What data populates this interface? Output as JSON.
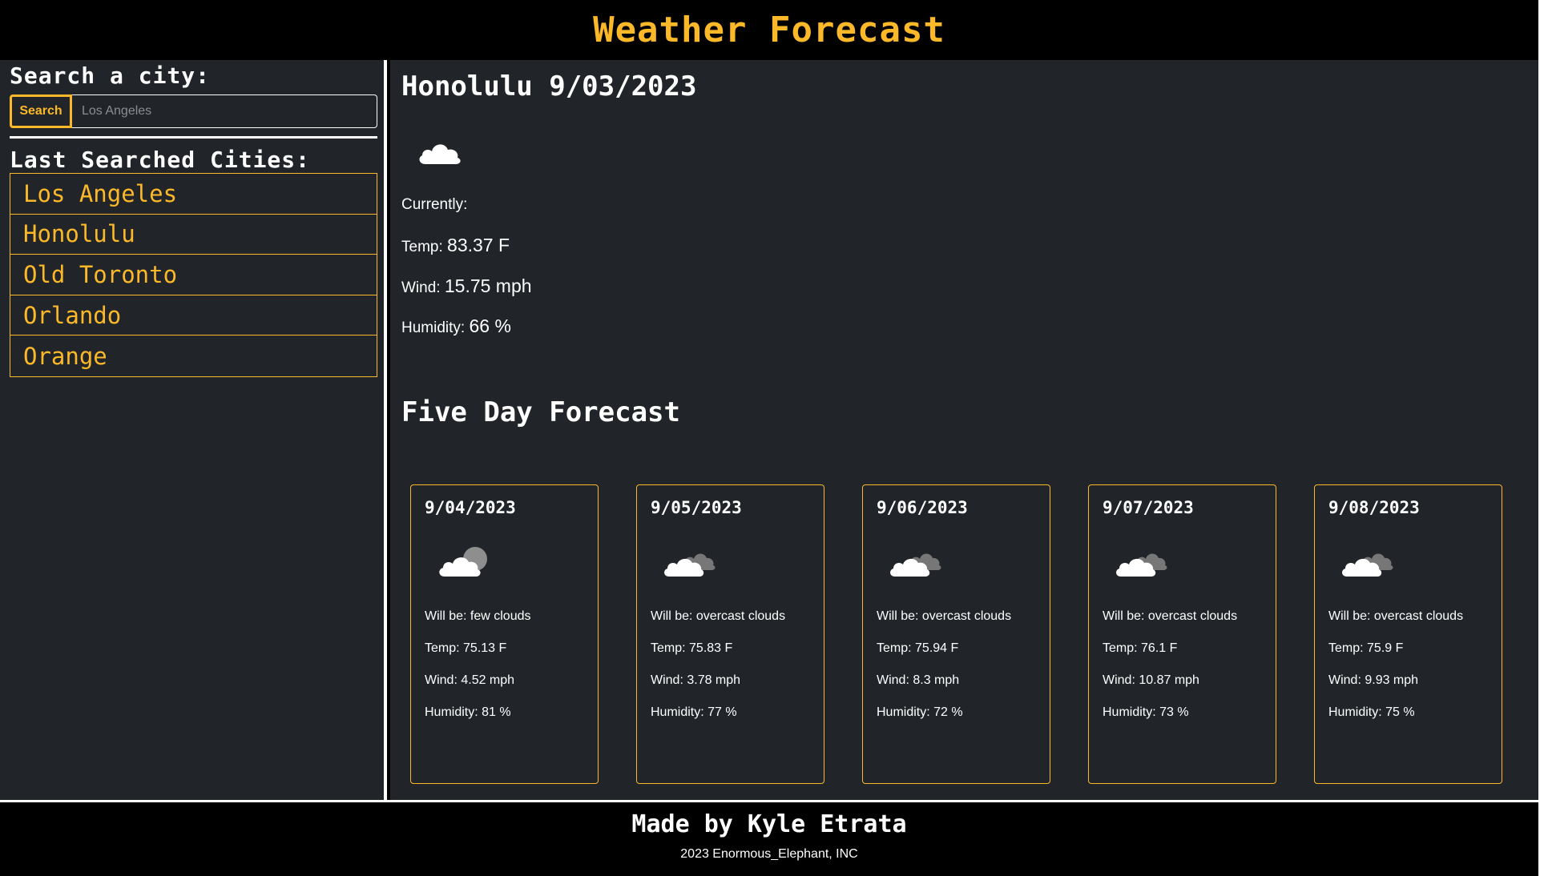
{
  "app": {
    "title": "Weather Forecast"
  },
  "colors": {
    "accent": "#fbb829",
    "panel": "#212529",
    "background": "#000000",
    "text": "#ffffff"
  },
  "sidebar": {
    "search_title": "Search a city:",
    "search_button": "Search",
    "search_placeholder": "Los Angeles",
    "search_value": "",
    "last_title": "Last Searched Cities:",
    "cities": [
      "Los Angeles",
      "Honolulu",
      "Old Toronto",
      "Orlando",
      "Orange"
    ]
  },
  "current": {
    "title": "Honolulu 9/03/2023",
    "icon": "cloud-icon",
    "currently_label": "Currently:",
    "temp_label": "Temp:",
    "temp_value": "83.37 F",
    "wind_label": "Wind:",
    "wind_value": "15.75 mph",
    "humidity_label": "Humidity:",
    "humidity_value": "66 %"
  },
  "forecast": {
    "title": "Five Day Forecast",
    "days": [
      {
        "date": "9/04/2023",
        "icon": "few-clouds-icon",
        "desc": "Will be: few clouds",
        "temp": "Temp: 75.13 F",
        "wind": "Wind: 4.52 mph",
        "humidity": "Humidity: 81 %"
      },
      {
        "date": "9/05/2023",
        "icon": "overcast-clouds-icon",
        "desc": "Will be: overcast clouds",
        "temp": "Temp: 75.83 F",
        "wind": "Wind: 3.78 mph",
        "humidity": "Humidity: 77 %"
      },
      {
        "date": "9/06/2023",
        "icon": "overcast-clouds-icon",
        "desc": "Will be: overcast clouds",
        "temp": "Temp: 75.94 F",
        "wind": "Wind: 8.3 mph",
        "humidity": "Humidity: 72 %"
      },
      {
        "date": "9/07/2023",
        "icon": "overcast-clouds-icon",
        "desc": "Will be: overcast clouds",
        "temp": "Temp: 76.1 F",
        "wind": "Wind: 10.87 mph",
        "humidity": "Humidity: 73 %"
      },
      {
        "date": "9/08/2023",
        "icon": "overcast-clouds-icon",
        "desc": "Will be: overcast clouds",
        "temp": "Temp: 75.9 F",
        "wind": "Wind: 9.93 mph",
        "humidity": "Humidity: 75 %"
      }
    ]
  },
  "footer": {
    "made_by": "Made by Kyle Etrata",
    "copyright": "2023 Enormous_Elephant, INC"
  }
}
